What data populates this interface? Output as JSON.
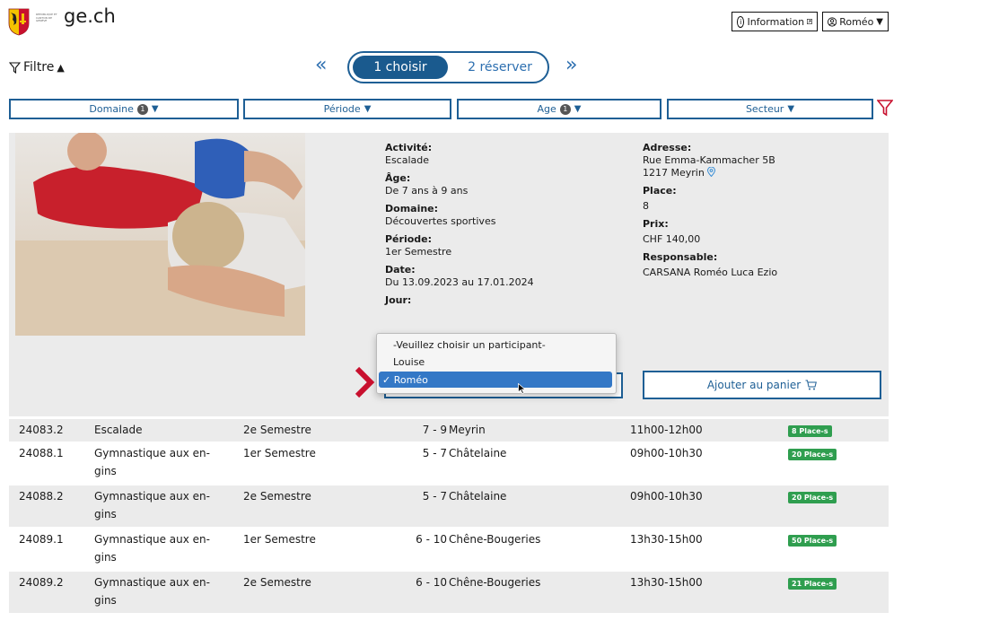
{
  "header": {
    "site_name": "ge.ch",
    "logo_text": "RÉPUBLIQUE ET CANTON DE GENÈVE",
    "info_label": "Information",
    "user_label": "Roméo"
  },
  "toolbar": {
    "filtre_label": "Filtre",
    "step1_label": "1 choisir",
    "step2_label": "2 réserver",
    "prev_symbol": "«",
    "next_symbol": "»"
  },
  "filters": [
    {
      "label": "Domaine",
      "count": "1"
    },
    {
      "label": "Période",
      "count": ""
    },
    {
      "label": "Age",
      "count": "1"
    },
    {
      "label": "Secteur",
      "count": ""
    }
  ],
  "detail": {
    "activite_label": "Activité:",
    "activite": "Escalade",
    "age_label": "Âge:",
    "age": "De 7 ans à 9 ans",
    "domaine_label": "Domaine:",
    "domaine": "Découvertes sportives",
    "periode_label": "Période:",
    "periode": "1er Semestre",
    "date_label": "Date:",
    "date": "Du 13.09.2023 au 17.01.2024",
    "jour_label": "Jour:",
    "adresse_label": "Adresse:",
    "adresse_line1": "Rue Emma-Kammacher 5B",
    "adresse_line2": "1217 Meyrin",
    "place_label": "Place:",
    "place": "8",
    "prix_label": "Prix:",
    "prix": "CHF 140,00",
    "responsable_label": "Responsable:",
    "responsable": "CARSANA Roméo Luca Ezio",
    "cart_button": "Ajouter au panier"
  },
  "participant_dropdown": {
    "options": [
      "-Veuillez choisir un participant-",
      "Louise",
      "Roméo"
    ],
    "selected": "Roméo"
  },
  "table_rows": [
    {
      "id": "24083.2",
      "activite": "Escalade",
      "activite2": "",
      "periode": "2e Semestre",
      "age": "7 - 9",
      "lieu": "Meyrin",
      "horaire": "11h00-12h00",
      "places": "8 Place-s"
    },
    {
      "id": "24088.1",
      "activite": "Gymnastique aux en-",
      "activite2": "gins",
      "periode": "1er Semestre",
      "age": "5 - 7",
      "lieu": "Châtelaine",
      "horaire": "09h00-10h30",
      "places": "20 Place-s"
    },
    {
      "id": "24088.2",
      "activite": "Gymnastique aux en-",
      "activite2": "gins",
      "periode": "2e Semestre",
      "age": "5 - 7",
      "lieu": "Châtelaine",
      "horaire": "09h00-10h30",
      "places": "20 Place-s"
    },
    {
      "id": "24089.1",
      "activite": "Gymnastique aux en-",
      "activite2": "gins",
      "periode": "1er Semestre",
      "age": "6 - 10",
      "lieu": "Chêne-Bougeries",
      "horaire": "13h30-15h00",
      "places": "50 Place-s"
    },
    {
      "id": "24089.2",
      "activite": "Gymnastique aux en-",
      "activite2": "gins",
      "periode": "2e Semestre",
      "age": "6 - 10",
      "lieu": "Chêne-Bougeries",
      "horaire": "13h30-15h00",
      "places": "21 Place-s"
    }
  ],
  "colors": {
    "primary_blue": "#1e5f95",
    "active_step": "#1a5a8e",
    "badge_green": "#2f9e4f",
    "highlight_red": "#c8102e",
    "dropdown_selected": "#3478c6"
  }
}
